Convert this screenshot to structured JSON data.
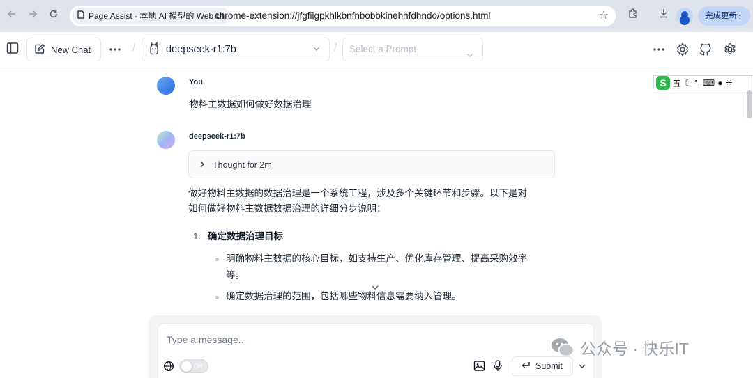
{
  "browser": {
    "tab_title": "Page Assist - 本地 AI 模型的 Web UI",
    "url": "chrome-extension://jfgfiigpkhlkbnfnbobbkinehhfdhndo/options.html",
    "update_label": "完成更新"
  },
  "header": {
    "new_chat_label": "New Chat",
    "model_selected": "deepseek-r1:7b",
    "prompt_placeholder": "Select a Prompt"
  },
  "chat": {
    "user": {
      "sender": "You",
      "text": "物料主数据如何做好数据治理"
    },
    "assistant": {
      "sender": "deepseek-r1:7b",
      "thought_label": "Thought for 2m",
      "intro_line1": "做好物料主数据的数据治理是一个系统工程，涉及多个关键环节和步骤。以下是对",
      "intro_line2": "如何做好物料主数据数据治理的详细分步说明：",
      "list": [
        {
          "number": "1.",
          "heading": "确定数据治理目标",
          "bullets": [
            {
              "line1": "明确物料主数据的核心目标，如支持生产、优化库存管理、提高采购效率",
              "line2": "等。"
            },
            {
              "line1": "确定数据治理的范围，包括哪些物料信息需要纳入管理。",
              "line2": ""
            }
          ]
        }
      ]
    }
  },
  "composer": {
    "placeholder": "Type a message...",
    "toggle_label": "Off",
    "submit_label": "Submit"
  },
  "ime": {
    "logo": "S",
    "mode": "五",
    "punct": "°,"
  },
  "watermark": {
    "text": "公众号 · 快乐IT"
  }
}
